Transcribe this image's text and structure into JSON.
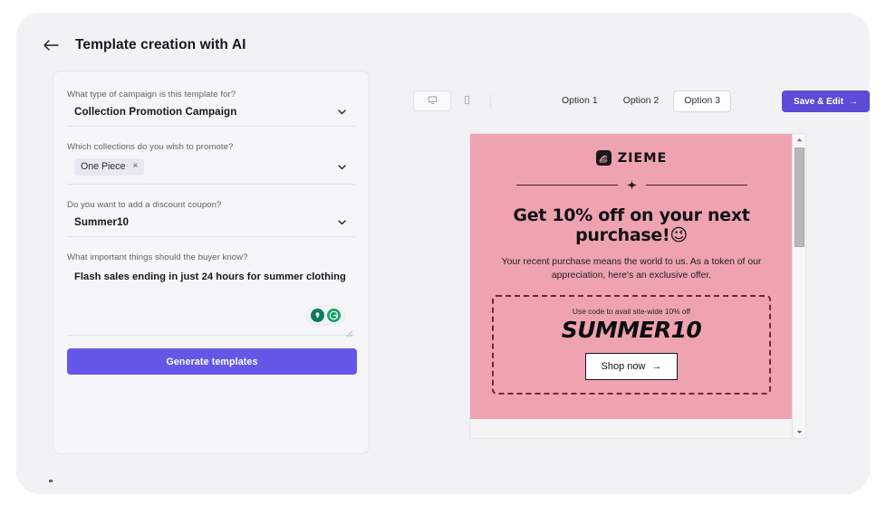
{
  "header": {
    "back_icon": "arrow-left-icon",
    "title": "Template creation with AI"
  },
  "form": {
    "fields": [
      {
        "label": "What type of campaign is this template for?",
        "value": "Collection Promotion Campaign",
        "type": "select"
      },
      {
        "label": "Which collections do you wish to promote?",
        "chip": "One Piece",
        "chip_remove": "×",
        "type": "multiselect"
      },
      {
        "label": "Do you want to add a discount coupon?",
        "value": "Summer10",
        "type": "select"
      },
      {
        "label": "What important things should the buyer know?",
        "value": "Flash sales ending in just 24 hours for summer clothing",
        "type": "textarea"
      }
    ],
    "assist_icons": [
      "lightbulb-icon",
      "grammarly-icon"
    ],
    "submit_label": "Generate templates"
  },
  "toolbar": {
    "device_desktop_icon": "desktop-icon",
    "device_mobile_icon": "mobile-icon",
    "tabs": [
      {
        "label": "Option 1",
        "active": false
      },
      {
        "label": "Option 2",
        "active": false
      },
      {
        "label": "Option 3",
        "active": true
      }
    ],
    "save_label": "Save & Edit",
    "save_arrow": "→"
  },
  "email": {
    "brand_name": "ZIEME",
    "brand_mark_icon": "swirl-logo-icon",
    "divider_icon": "sparkle-icon",
    "headline": "Get 10% off on your next purchase!",
    "headline_emoji": "😉",
    "subcopy": "Your recent purchase means the world to us. As a token of our appreciation, here's an exclusive offer.",
    "coupon_caption": "Use code to avail site-wide 10% off",
    "coupon_code": "SUMMER10",
    "cta_label": "Shop now",
    "cta_arrow": "→"
  },
  "colors": {
    "accent_purple": "#6457e8",
    "save_purple": "#5b4bd6",
    "email_pink": "#efa3b0",
    "coupon_border": "#7a2330",
    "shell_bg": "#f2f2f4"
  }
}
